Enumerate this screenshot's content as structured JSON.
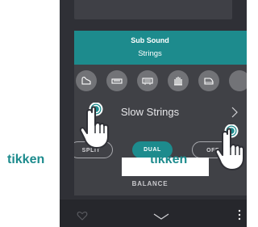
{
  "card": {
    "title": "Sub Sound",
    "subtitle": "Strings",
    "selected_sound": "Slow Strings"
  },
  "categories": [
    {
      "icon": "grand-piano-icon"
    },
    {
      "icon": "electric-piano-icon"
    },
    {
      "icon": "harpsichord-icon"
    },
    {
      "icon": "organ-pipes-icon"
    },
    {
      "icon": "upright-piano-icon"
    }
  ],
  "modes": {
    "split_label": "SPLIT",
    "dual_label": "DUAL",
    "off_label": "OFF"
  },
  "balance": {
    "label": "BALANCE"
  },
  "annotations": {
    "left_tap": "tikken",
    "right_tap": "tikken"
  },
  "bottom_bar": {
    "favorite_icon": "heart-icon",
    "collapse_icon": "chevron-down-icon",
    "menu_icon": "more-vertical-icon"
  },
  "colors": {
    "accent": "#1d8b8d",
    "panel": "#404146",
    "background": "#2f3036",
    "text_light": "#e7e7ea"
  }
}
